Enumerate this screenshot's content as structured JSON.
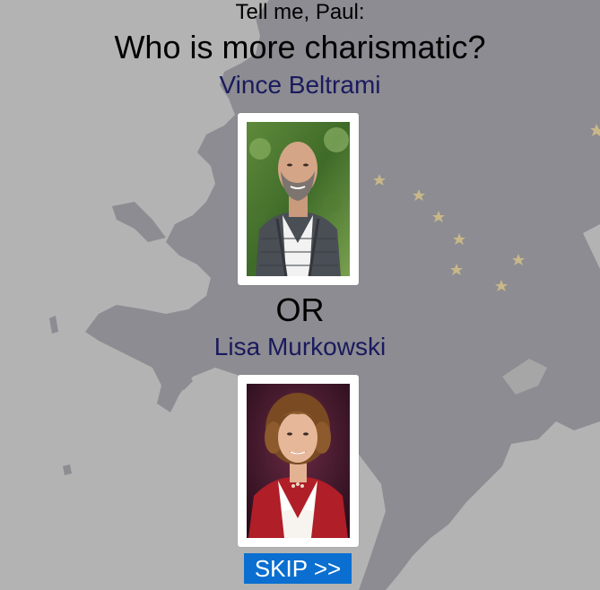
{
  "prompt": "Tell me, Paul:",
  "question": "Who is more charismatic?",
  "candidates": [
    {
      "name": "Vince Beltrami",
      "photo_alt": "Vince Beltrami"
    },
    {
      "name": "Lisa Murkowski",
      "photo_alt": "Lisa Murkowski"
    }
  ],
  "or_label": "OR",
  "skip_label": "SKIP >>",
  "colors": {
    "background": "#b3b3b3",
    "map": "#8c8c92",
    "stars": "#c8b788",
    "name": "#1a1a5e",
    "skip_button": "#0a6fd0"
  }
}
